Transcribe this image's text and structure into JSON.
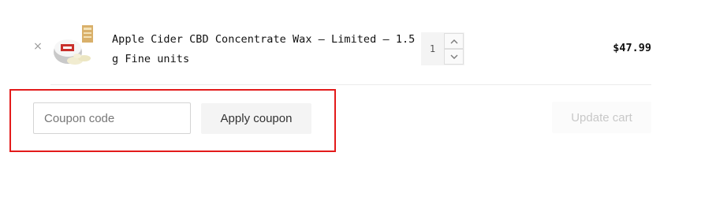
{
  "cart_item": {
    "remove_label": "×",
    "thumbnail_icon": "product-thumbnail",
    "product_name": "Apple Cider CBD Concentrate Wax – Limited – 1.5 g Fine units",
    "quantity": "1",
    "price": "$47.99"
  },
  "coupon": {
    "placeholder": "Coupon code",
    "value": "",
    "apply_label": "Apply coupon"
  },
  "actions": {
    "update_cart_label": "Update cart"
  },
  "colors": {
    "highlight": "#e31b1b",
    "button_bg": "#f4f4f4",
    "disabled_text": "#c8c8c8"
  }
}
